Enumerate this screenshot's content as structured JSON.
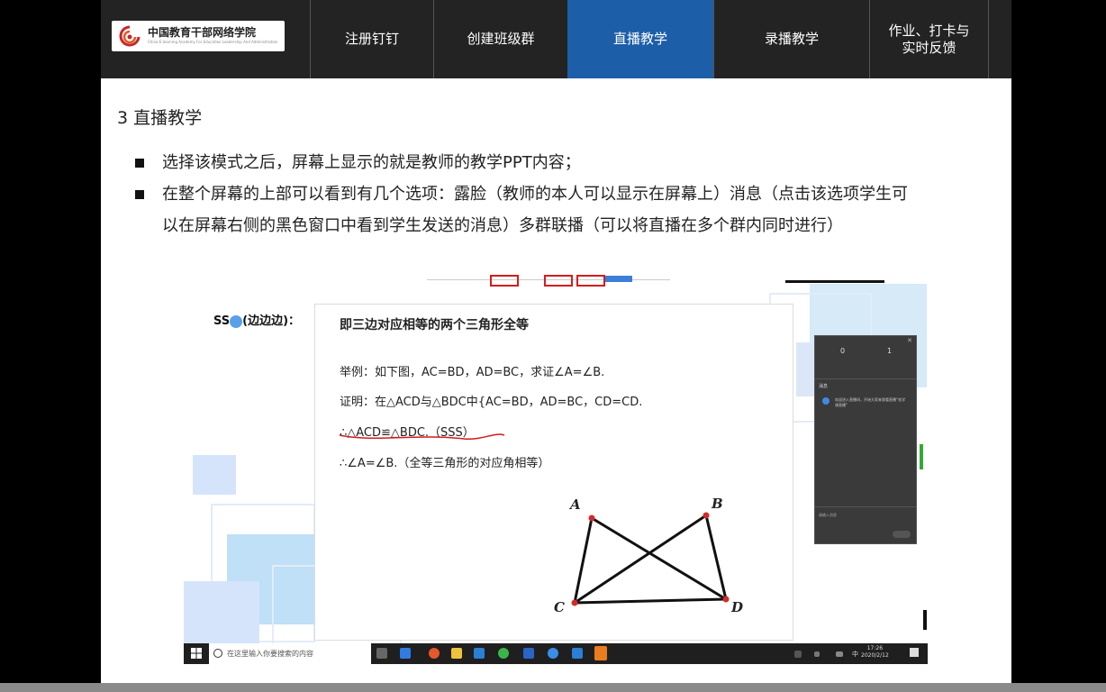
{
  "logo": {
    "name_cn": "中国教育干部网络学院",
    "name_en": "China E-learning Academy For Education Leadership And Administration"
  },
  "nav": {
    "items": [
      {
        "label": "注册钉钉"
      },
      {
        "label": "创建班级群"
      },
      {
        "label": "直播教学",
        "active": true
      },
      {
        "label": "录播教学"
      },
      {
        "label_line1": "作业、打卡与",
        "label_line2": "实时反馈"
      }
    ]
  },
  "content": {
    "heading": "3 直播教学",
    "bullets": [
      "选择该模式之后，屏幕上显示的就是教师的教学PPT内容；",
      "在整个屏幕的上部可以看到有几个选项：露脸（教师的本人可以显示在屏幕上）消息（点击该选项学生可以在屏幕右侧的黑色窗口中看到学生发送的消息）多群联播（可以将直播在多个群内同时进行）"
    ]
  },
  "screenshot": {
    "sss_label": "SS",
    "sss_label_2": "(边边边)：",
    "theorem": "即三边对应相等的两个三角形全等",
    "lines": [
      "举例：如下图，AC=BD，AD=BC，求证∠A=∠B.",
      "证明：在△ACD与△BDC中{AC=BD，AD=BC，CD=CD.",
      "∴△ACD≌△BDC.（SSS）",
      "∴∠A=∠B.（全等三角形的对应角相等）"
    ],
    "vertices": {
      "a": "A",
      "b": "B",
      "c": "C",
      "d": "D"
    },
    "side_panel": {
      "stat1": "0",
      "stat2": "1",
      "msg_header": "消息",
      "msg_text": "欢迎进入直播间，开始大家来观看直播“农学课直播”",
      "input_placeholder": "请输入消息"
    },
    "taskbar": {
      "search_placeholder": "在这里输入你要搜索的内容",
      "ime": "中",
      "time": "17:26",
      "date": "2020/2/12"
    }
  },
  "colors": {
    "nav_bg": "#232323",
    "nav_active": "#1c5ea8",
    "highlight_red": "#d41c1c"
  }
}
